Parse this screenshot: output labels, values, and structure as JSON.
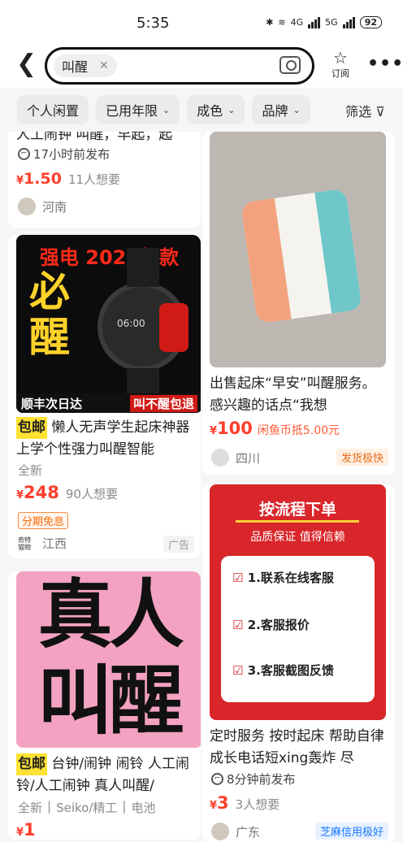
{
  "status_bar": {
    "time": "5:35",
    "network_1": "4G",
    "network_2": "5G",
    "battery": "92"
  },
  "header": {
    "back_icon": "chevron-left-icon",
    "search_chip": "叫醒",
    "subscribe_label": "订阅"
  },
  "filters": [
    {
      "label": "个人闲置",
      "has_arrow": false
    },
    {
      "label": "已用年限",
      "has_arrow": true
    },
    {
      "label": "成色",
      "has_arrow": true
    },
    {
      "label": "品牌",
      "has_arrow": true
    }
  ],
  "filter_select": "筛选",
  "left_cards": [
    {
      "title_tail": "人工闹钟 叫醒，早起，起",
      "time_badge": "17小时前发布",
      "price": "1.50",
      "wants": "11人想要",
      "location": "河南"
    },
    {
      "img_top": "强电 2024新款",
      "img_big": "必醒",
      "watch_time": "06:00",
      "img_bar_left": "顺丰次日达",
      "img_bar_right": "叫不醒包退",
      "tag": "包邮",
      "title": "懒人无声学生起床神器上学个性强力叫醒智能",
      "condition": "全新",
      "price": "248",
      "wants": "90人想要",
      "promo": "分期免息",
      "seller_mark": "奇特 猫物",
      "location": "江西",
      "ad": "广告"
    },
    {
      "img_line1": "真人",
      "img_line2": "叫醒",
      "tag": "包邮",
      "title": "台钟/闹钟 闹铃 人工闹铃/人工闹钟 真人叫醒/",
      "meta": [
        "全新",
        "Seiko/精工",
        "电池"
      ],
      "price": "1"
    }
  ],
  "right_cards": [
    {
      "title": "出售起床“早安”叫醒服务。 感兴趣的话点“我想",
      "price": "100",
      "coin": "闲鱼币抵5.00元",
      "location": "四川",
      "badge": "发货极快"
    },
    {
      "poster_title": "按流程下单",
      "poster_sub": "品质保证 值得信赖",
      "steps": [
        "1.联系在线客服",
        "2.客服报价",
        "3.客服截图反馈"
      ],
      "title": "定时服务 按时起床 帮助自律成长电话短xing轰炸 尽",
      "time_badge": "8分钟前发布",
      "price": "3",
      "wants": "3人想要",
      "location": "广东",
      "credit": "芝麻信用极好"
    }
  ],
  "colors": {
    "price": "#ff3e2d",
    "tag": "#ffe234",
    "poster_red": "#d8262a"
  }
}
